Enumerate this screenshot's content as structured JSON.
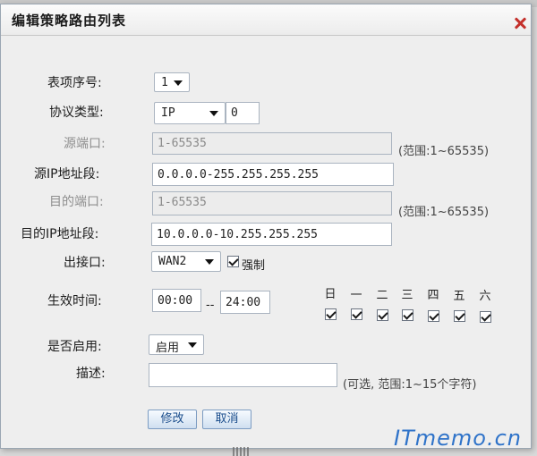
{
  "dialog": {
    "title": "编辑策略路由列表"
  },
  "form": {
    "entry_no": {
      "label": "表项序号:",
      "value": "1"
    },
    "protocol": {
      "label": "协议类型:",
      "value": "IP",
      "number": "0"
    },
    "src_port": {
      "label": "源端口:",
      "value": "1-65535",
      "hint": "(范围:1~65535)"
    },
    "src_ip": {
      "label": "源IP地址段:",
      "value": "0.0.0.0-255.255.255.255"
    },
    "dst_port": {
      "label": "目的端口:",
      "value": "1-65535",
      "hint": "(范围:1~65535)"
    },
    "dst_ip": {
      "label": "目的IP地址段:",
      "value": "10.0.0.0-10.255.255.255"
    },
    "interface": {
      "label": "出接口:",
      "value": "WAN2",
      "force_label": "强制",
      "force_checked": true
    },
    "effective_time": {
      "label": "生效时间:",
      "start": "00:00",
      "separator": "--",
      "end": "24:00",
      "days": [
        {
          "label": "日",
          "checked": true
        },
        {
          "label": "一",
          "checked": true
        },
        {
          "label": "二",
          "checked": true
        },
        {
          "label": "三",
          "checked": true
        },
        {
          "label": "四",
          "checked": true
        },
        {
          "label": "五",
          "checked": true
        },
        {
          "label": "六",
          "checked": true
        }
      ]
    },
    "enabled": {
      "label": "是否启用:",
      "value": "启用"
    },
    "description": {
      "label": "描述:",
      "value": "",
      "hint": "(可选, 范围:1~15个字符)"
    }
  },
  "buttons": {
    "modify": "修改",
    "cancel": "取消"
  },
  "watermark": "ITmemo.cn"
}
